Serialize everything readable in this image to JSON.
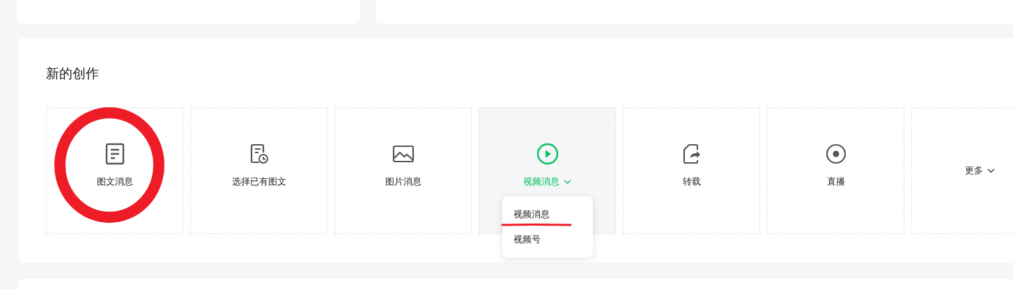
{
  "section": {
    "title": "新的创作"
  },
  "tiles": [
    {
      "kind": "article",
      "label": "图文消息",
      "active": false
    },
    {
      "kind": "select_article",
      "label": "选择已有图文",
      "active": false
    },
    {
      "kind": "image",
      "label": "图片消息",
      "active": false
    },
    {
      "kind": "video",
      "label": "视频消息",
      "active": true,
      "expanded": true,
      "menu": [
        "视频消息",
        "视频号"
      ]
    },
    {
      "kind": "repost",
      "label": "转载",
      "active": false
    },
    {
      "kind": "live",
      "label": "直播",
      "active": false
    },
    {
      "kind": "more",
      "label": "更多",
      "active": false
    }
  ],
  "annotations": {
    "circle_marked": true,
    "underline_marked": true
  }
}
